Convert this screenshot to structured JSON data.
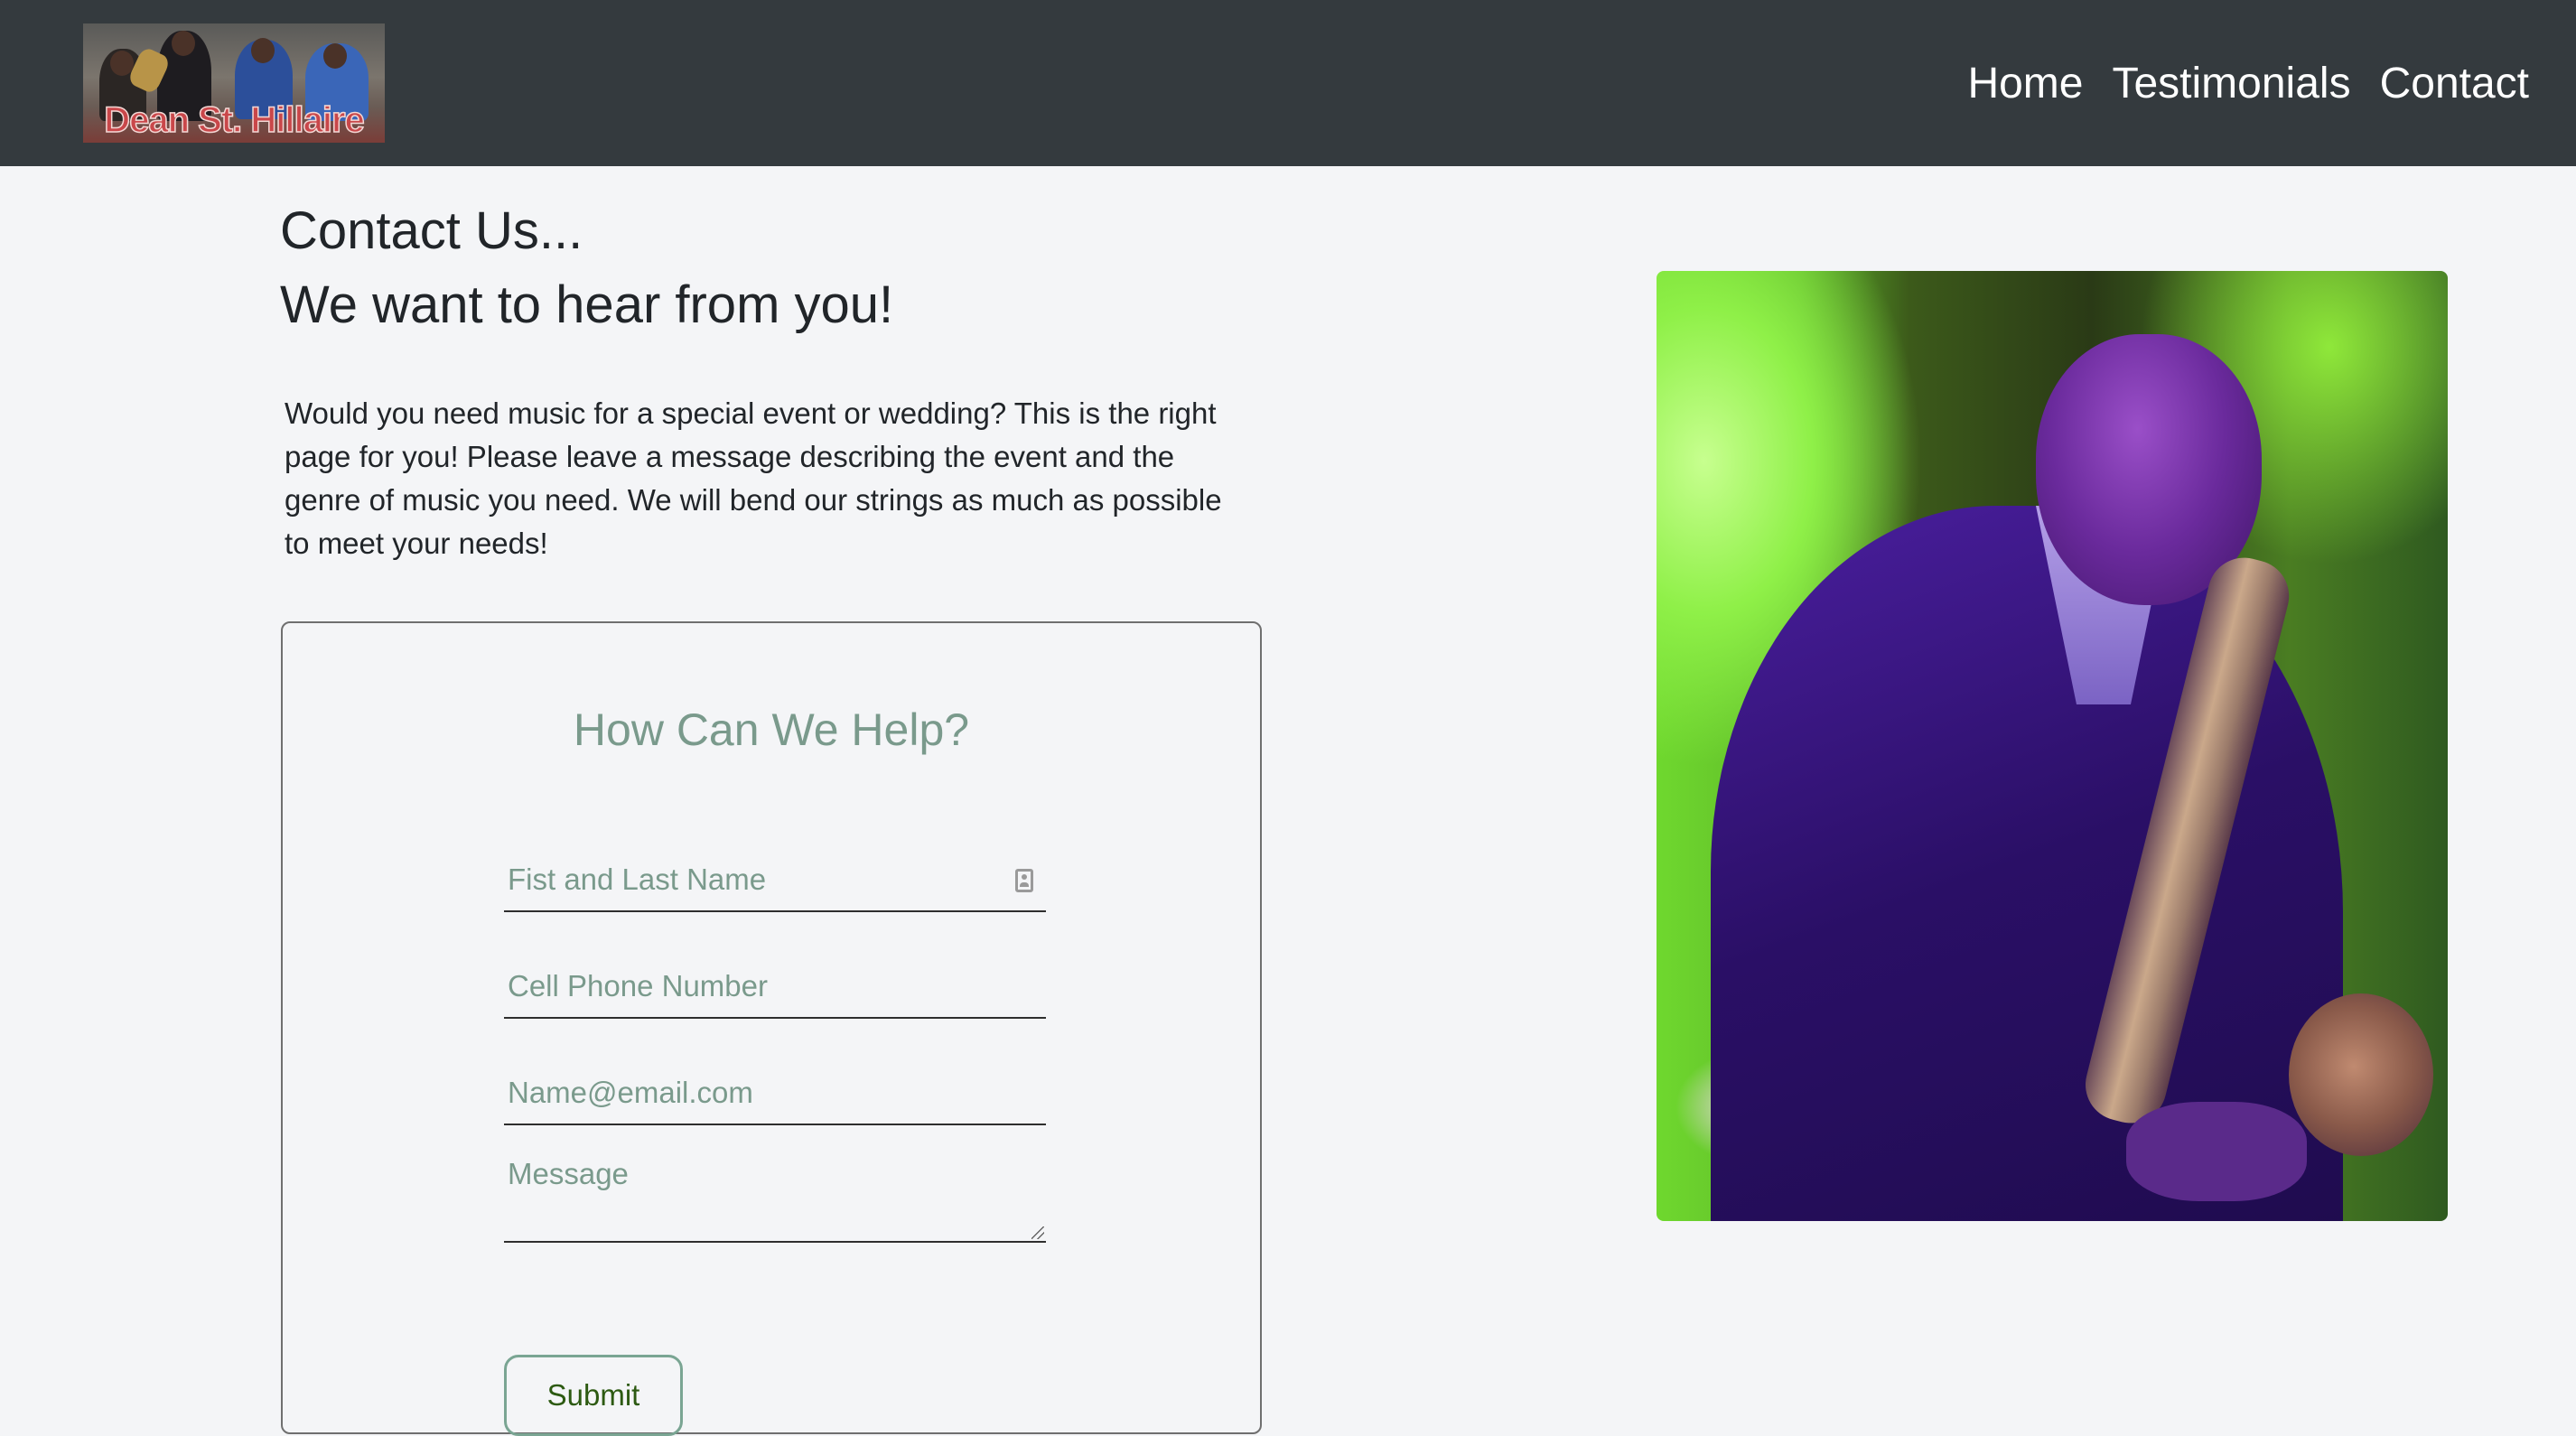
{
  "header": {
    "logo_text": "Dean St. Hillaire",
    "nav": [
      {
        "label": "Home"
      },
      {
        "label": "Testimonials"
      },
      {
        "label": "Contact"
      }
    ]
  },
  "main": {
    "heading": "Contact Us...",
    "subheading": "We want to hear from you!",
    "intro": "Would you need music for a special event or wedding? This is the right page for you! Please leave a message describing the event and the genre of music you need. We will bend our strings as much as possible to meet your needs!"
  },
  "form": {
    "title": "How Can We Help?",
    "name_placeholder": "Fist and Last Name",
    "phone_placeholder": "Cell Phone Number",
    "email_placeholder": "Name@email.com",
    "message_placeholder": "Message",
    "submit_label": "Submit"
  },
  "icons": {
    "name_field_icon": "contact-card-icon"
  },
  "colors": {
    "topbar": "#343a3e",
    "background": "#f4f5f7",
    "form_accent": "#7a9a8c",
    "submit_text": "#2d5a12"
  }
}
